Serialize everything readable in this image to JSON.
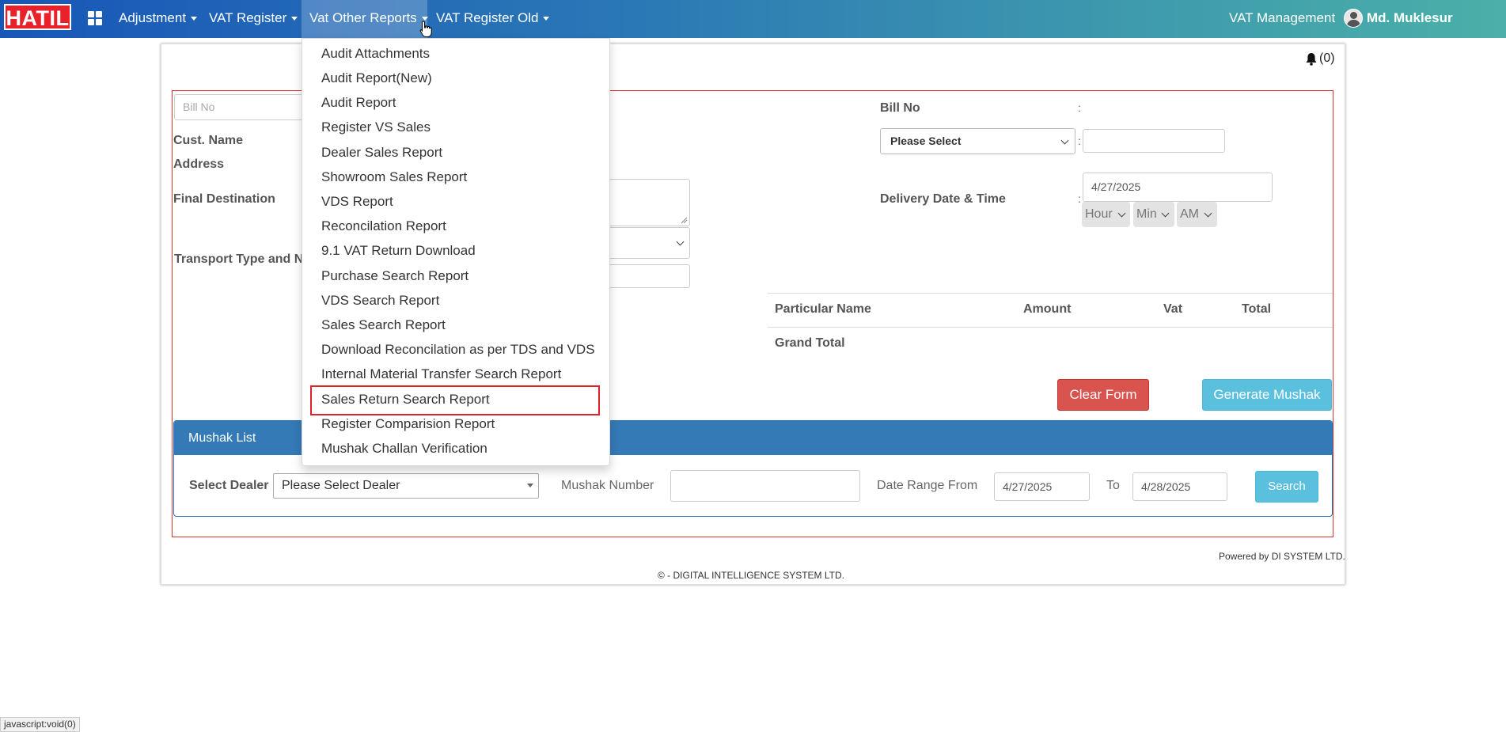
{
  "navbar": {
    "logo": "HATIL",
    "menu": [
      {
        "label": "Adjustment"
      },
      {
        "label": "VAT Register"
      },
      {
        "label": "Vat Other Reports"
      },
      {
        "label": "VAT Register Old"
      }
    ],
    "app_title": "VAT Management",
    "user_name": "Md. Muklesur Rahman"
  },
  "notification": {
    "count": "(0)"
  },
  "form": {
    "bill_no_placeholder": "Bill No",
    "cust_name_label": "Cust. Name",
    "address_label": "Address",
    "final_destination_label": "Final Destination",
    "transport_label": "Transport Type and Nu",
    "bill_no_label": "Bill No",
    "bill_no_select": "Please Select",
    "delivery_label": "Delivery Date & Time",
    "delivery_date": "4/27/2025",
    "hour": "Hour",
    "min": "Min",
    "ampm": "AM"
  },
  "particulars": {
    "headers": [
      "Particular Name",
      "Amount",
      "Vat",
      "Total"
    ],
    "grand_total_label": "Grand Total"
  },
  "buttons": {
    "clear": "Clear Form",
    "generate": "Generate Mushak"
  },
  "mushak_list": {
    "title": "Mushak List",
    "select_dealer_label": "Select Dealer",
    "dealer_value": "Please Select Dealer",
    "mushak_number_label": "Mushak Number",
    "date_range_label": "Date Range From",
    "date_from": "4/27/2025",
    "to_label": "To",
    "date_to": "4/28/2025",
    "search_label": "Search"
  },
  "dropdown": {
    "items": [
      "Audit Attachments",
      "Audit Report(New)",
      "Audit Report",
      "Register VS Sales",
      "Dealer Sales Report",
      "Showroom Sales Report",
      "VDS Report",
      "Reconcilation Report",
      "9.1 VAT Return Download",
      "Purchase Search Report",
      "VDS Search Report",
      "Sales Search Report",
      "Download Reconcilation as per TDS and VDS",
      "Internal Material Transfer Search Report",
      "Sales Return Search Report",
      "Register Comparision Report",
      "Mushak Challan Verification"
    ],
    "highlighted": "Sales Return Search Report"
  },
  "footer": {
    "powered": "Powered by DI SYSTEM LTD.",
    "copyright": "©  - DIGITAL INTELLIGENCE SYSTEM LTD."
  },
  "status_bar": "javascript:void(0)",
  "colors": {
    "nav_start": "#1857b8",
    "nav_end": "#4ab0a8",
    "logo_red": "#e8212a",
    "danger": "#d9534f",
    "info": "#5bc0de",
    "panel_heading": "#337ab7"
  }
}
